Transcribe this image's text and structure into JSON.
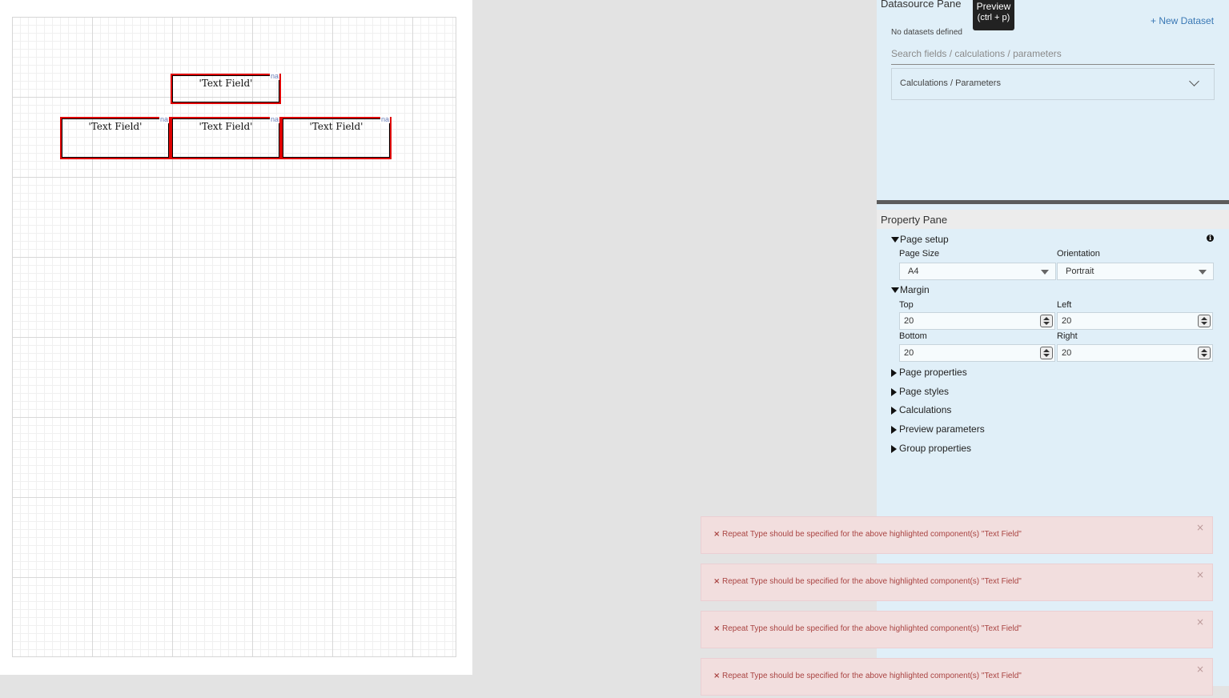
{
  "canvas": {
    "text_fields": [
      {
        "label": "'Text Field'",
        "tag": "na"
      },
      {
        "label": "'Text Field'",
        "tag": "na"
      },
      {
        "label": "'Text Field'",
        "tag": "na"
      },
      {
        "label": "'Text Field'",
        "tag": "na"
      }
    ]
  },
  "tooltip": {
    "line1": "Preview",
    "line2": "(ctrl + p)"
  },
  "datasource": {
    "header": "Datasource Pane",
    "new_dataset": "+ New Dataset",
    "no_datasets": "No datasets defined",
    "search_placeholder": "Search fields / calculations / parameters",
    "calc_dropdown_label": "Calculations / Parameters"
  },
  "property_pane": {
    "header": "Property Pane",
    "page_setup": {
      "title": "Page setup",
      "page_size_label": "Page Size",
      "page_size_value": "A4",
      "orientation_label": "Orientation",
      "orientation_value": "Portrait"
    },
    "margin": {
      "title": "Margin",
      "top_label": "Top",
      "top_value": "20",
      "left_label": "Left",
      "left_value": "20",
      "bottom_label": "Bottom",
      "bottom_value": "20",
      "right_label": "Right",
      "right_value": "20"
    },
    "sections": [
      "Page properties",
      "Page styles",
      "Calculations",
      "Preview parameters",
      "Group properties"
    ]
  },
  "toasts": [
    {
      "icon": "×",
      "message": "Repeat Type should be specified for the above highlighted component(s) \"Text Field\"",
      "close": "×"
    },
    {
      "icon": "×",
      "message": "Repeat Type should be specified for the above highlighted component(s) \"Text Field\"",
      "close": "×"
    },
    {
      "icon": "×",
      "message": "Repeat Type should be specified for the above highlighted component(s) \"Text Field\"",
      "close": "×"
    },
    {
      "icon": "×",
      "message": "Repeat Type should be specified for the above highlighted component(s) \"Text Field\"",
      "close": "×"
    }
  ],
  "colors": {
    "error_text": "#a94442",
    "toast_bg": "#f2dede",
    "panel_bg": "#e0eff8",
    "field_border": "#e00000",
    "link": "#3a78b5"
  }
}
